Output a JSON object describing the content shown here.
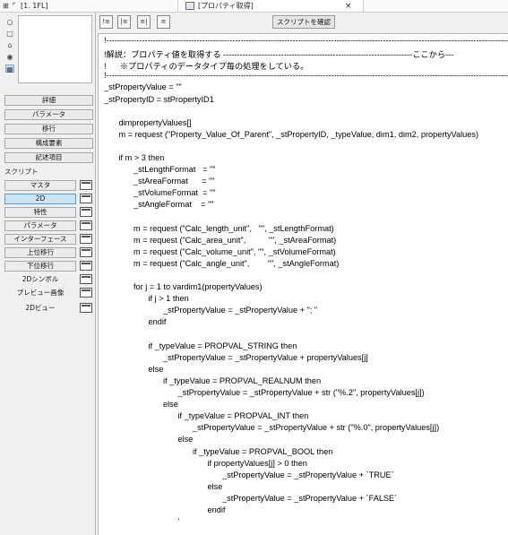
{
  "tabbar": {
    "left_tab": "[1. 1FL]",
    "window_title": "[プロパティ取得]",
    "close_glyph": "×"
  },
  "tools": [
    "○",
    "□",
    "⌂",
    "◉",
    "▦"
  ],
  "buttons": [
    "詳細",
    "パラメータ",
    "移行",
    "構成要素",
    "記述項目"
  ],
  "script_section_label": "スクリプト",
  "script_items": [
    {
      "label": "マスタ",
      "selected": false,
      "framed": true,
      "icon": true
    },
    {
      "label": "2D",
      "selected": true,
      "framed": true,
      "icon": true
    },
    {
      "label": "特性",
      "selected": false,
      "framed": true,
      "icon": true
    },
    {
      "label": "パラメータ",
      "selected": false,
      "framed": true,
      "icon": true
    },
    {
      "label": "インターフェース",
      "selected": false,
      "framed": true,
      "icon": true
    },
    {
      "label": "上位移行",
      "selected": false,
      "framed": true,
      "icon": true
    },
    {
      "label": "下位移行",
      "selected": false,
      "framed": true,
      "icon": true
    },
    {
      "label": "2Dシンボル",
      "selected": false,
      "framed": false,
      "icon": true
    },
    {
      "label": "プレビュー画像",
      "selected": false,
      "framed": false,
      "icon": true
    },
    {
      "label": "2Dビュー",
      "selected": false,
      "framed": false,
      "icon": true
    }
  ],
  "toolbar": {
    "icons": [
      "!≡",
      "|≡",
      "≡|",
      "≡"
    ],
    "check_button": "スクリプトを確認"
  },
  "code_lines": [
    {
      "t": "!-----------------------------------------------------------------------------------------------------------------------------------------------------",
      "i": 0
    },
    {
      "t": "!解説：プロパティ値を取得する ---------------------------------------------------------------------ここから---",
      "i": 0
    },
    {
      "t": "!      ※プロパティのデータタイプ毎の処理をしている。",
      "i": 0
    },
    {
      "t": "!-----------------------------------------------------------------------------------------------------------------------------------------------------",
      "i": 0
    },
    {
      "t": "_stPropertyValue = \"\"",
      "i": 0
    },
    {
      "t": "_stPropertyID = stPropertyID1",
      "i": 0
    },
    {
      "t": "",
      "i": 0
    },
    {
      "t": "dimpropertyValues[]",
      "i": 1
    },
    {
      "t": "m = request (\"Property_Value_Of_Parent\", _stPropertyID, _typeValue, dim1, dim2, propertyValues)",
      "i": 1
    },
    {
      "t": "",
      "i": 0
    },
    {
      "t": "if m > 3 then",
      "i": 1
    },
    {
      "t": "_stLengthFormat   = \"\"",
      "i": 2
    },
    {
      "t": "_stAreaFormat      = \"\"",
      "i": 2
    },
    {
      "t": "_stVolumeFormat  = \"\"",
      "i": 2
    },
    {
      "t": "_stAngleFormat    = \"\"",
      "i": 2
    },
    {
      "t": "",
      "i": 0
    },
    {
      "t": "m = request (\"Calc_length_unit\",   \"\", _stLengthFormat)",
      "i": 2
    },
    {
      "t": "m = request (\"Calc_area_unit\",          \"\", _stAreaFormat)",
      "i": 2
    },
    {
      "t": "m = request (\"Calc_volume_unit\", \"\", _stVolumeFormat)",
      "i": 2
    },
    {
      "t": "m = request (\"Calc_angle_unit\",        \"\", _stAngleFormat)",
      "i": 2
    },
    {
      "t": "",
      "i": 0
    },
    {
      "t": "for j = 1 to vardim1(propertyValues)",
      "i": 2
    },
    {
      "t": "if j > 1 then",
      "i": 3
    },
    {
      "t": "_stPropertyValue = _stPropertyValue + \"; \"",
      "i": 4
    },
    {
      "t": "endif",
      "i": 3
    },
    {
      "t": "",
      "i": 0
    },
    {
      "t": "if _typeValue = PROPVAL_STRING then",
      "i": 3
    },
    {
      "t": "_stPropertyValue = _stPropertyValue + propertyValues[j]",
      "i": 4
    },
    {
      "t": "else",
      "i": 3
    },
    {
      "t": "if _typeValue = PROPVAL_REALNUM then",
      "i": 4
    },
    {
      "t": "_stPropertyValue = _stPropertyValue + str (\"%.2\", propertyValues[j])",
      "i": 5
    },
    {
      "t": "else",
      "i": 4
    },
    {
      "t": "if _typeValue = PROPVAL_INT then",
      "i": 5
    },
    {
      "t": "_stPropertyValue = _stPropertyValue + str (\"%.0\", propertyValues[j])",
      "i": 6
    },
    {
      "t": "else",
      "i": 5
    },
    {
      "t": "if _typeValue = PROPVAL_BOOL then",
      "i": 6
    },
    {
      "t": "if propertyValues[j] > 0 then",
      "i": 7
    },
    {
      "t": "_stPropertyValue = _stPropertyValue + `TRUE`",
      "i": 8
    },
    {
      "t": "else",
      "i": 7
    },
    {
      "t": "_stPropertyValue = _stPropertyValue + `FALSE`",
      "i": 8
    },
    {
      "t": "endif",
      "i": 7
    },
    {
      "t": "'",
      "i": 5
    }
  ]
}
